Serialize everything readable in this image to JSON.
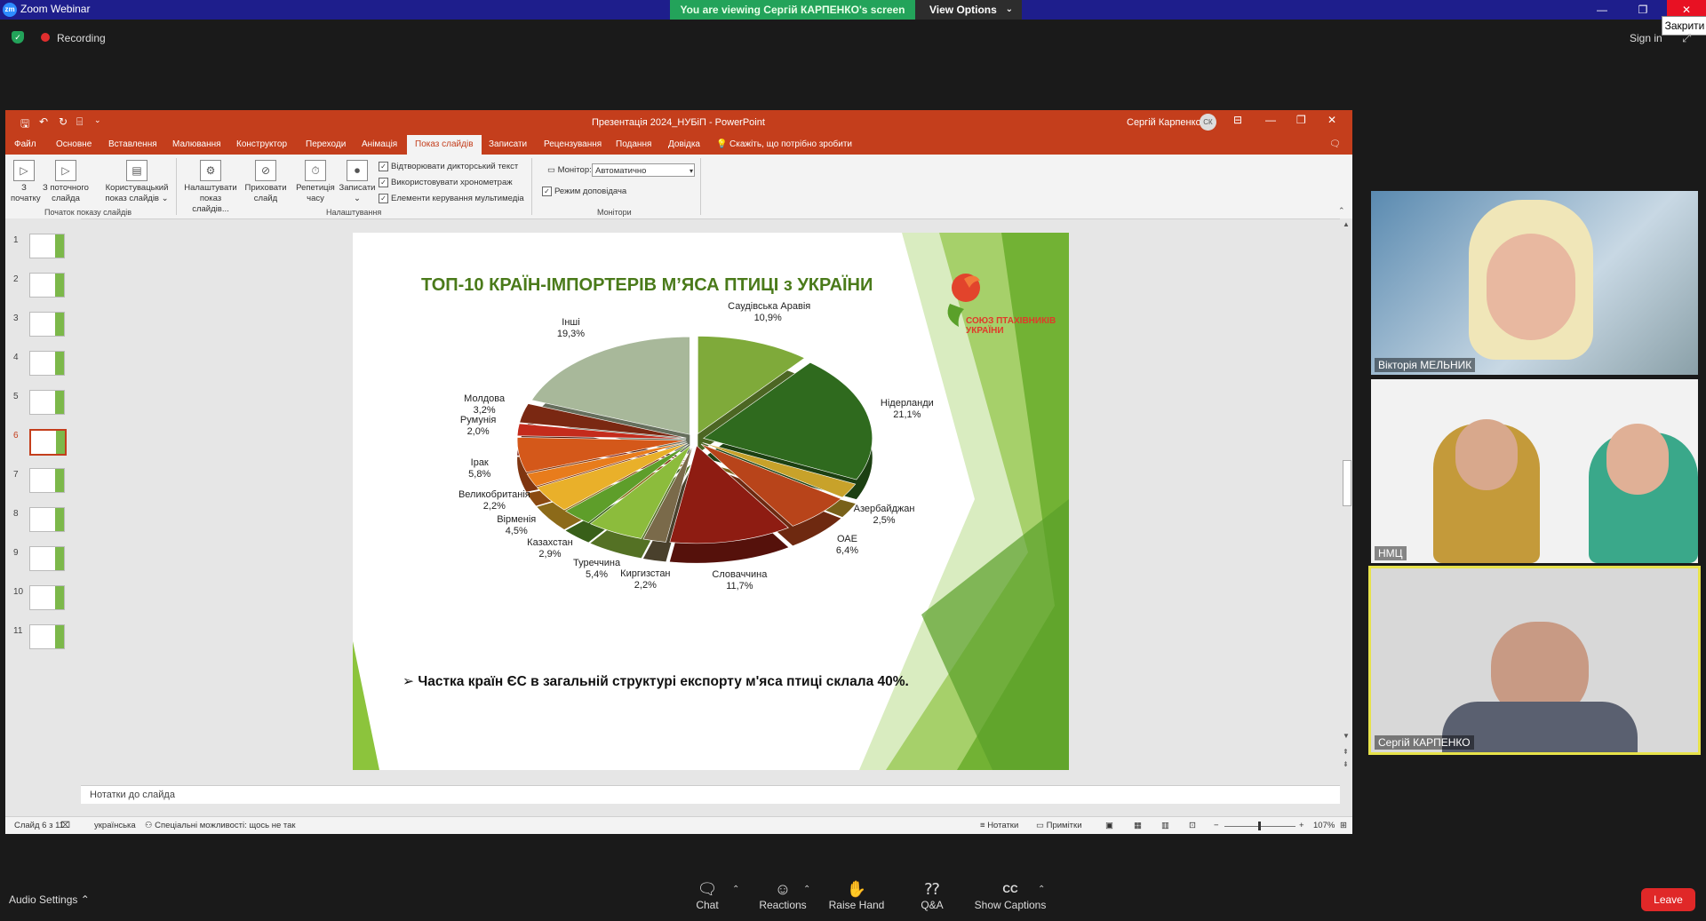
{
  "zoom": {
    "logo": "zm",
    "app_title": "Zoom Webinar",
    "viewing_banner": "You are viewing Сергій КАРПЕНКО's screen",
    "view_options": "View Options",
    "close_tooltip": "Закрити",
    "recording": "Recording",
    "sign_in": "Sign in"
  },
  "ppt": {
    "title": "Презентація 2024_НУБіП  -  PowerPoint",
    "user": "Сергій Карпенко",
    "user_initials": "СК",
    "tabs": [
      "Файл",
      "Основне",
      "Вставлення",
      "Малювання",
      "Конструктор",
      "Переходи",
      "Анімація",
      "Показ слайдів",
      "Записати",
      "Рецензування",
      "Подання",
      "Довідка"
    ],
    "tell_me": "Скажіть, що потрібно зробити",
    "ribbon": {
      "from_start": [
        "З",
        "початку"
      ],
      "from_current": [
        "З поточного",
        "слайда"
      ],
      "custom_show": [
        "Користувацький",
        "показ слайдів ⌄"
      ],
      "group_start": "Початок показу слайдів",
      "setup_show": [
        "Налаштувати",
        "показ слайдів..."
      ],
      "hide_slide": [
        "Приховати",
        "слайд"
      ],
      "rehearse": [
        "Репетиція",
        "часу"
      ],
      "record": [
        "Записати",
        "⌄"
      ],
      "check_narration": "Відтворювати дикторський текст",
      "check_timings": "Використовувати хронометраж",
      "check_media": "Елементи керування мультимедіа",
      "group_setup": "Налаштування",
      "monitor_label": "Монітор:",
      "monitor_value": "Автоматично",
      "presenter_view": "Режим доповідача",
      "group_monitors": "Монітори"
    },
    "thumbnails": [
      "1",
      "2",
      "3",
      "4",
      "5",
      "6",
      "7",
      "8",
      "9",
      "10",
      "11"
    ],
    "selected_slide": 6,
    "notes_placeholder": "Нотатки до слайда",
    "status": {
      "slide_count": "Слайд 6 з 11",
      "language": "українська",
      "accessibility": "Спеціальні можливості: щось не так",
      "notes": "Нотатки",
      "comments": "Примітки",
      "zoom_level": "107%"
    }
  },
  "slide": {
    "title": "ТОП-10 КРАЇН-ІМПОРТЕРІВ М’ЯСА ПТИЦІ з УКРАЇНИ",
    "logo_text": "СОЮЗ ПТАХІВНИКІВ УКРАЇНИ",
    "bullet_marker": "➢",
    "bullet": "Частка країн ЄС в загальній структурі експорту м'яса птиці склала 40%."
  },
  "chart_data": {
    "type": "pie",
    "categories": [
      "Саудівська Аравія",
      "Нідерланди",
      "Азербайджан",
      "ОАЕ",
      "Словаччина",
      "Киргизстан",
      "Туреччина",
      "Казахстан",
      "Вірменія",
      "Великобританія",
      "Ірак",
      "Румунія",
      "Молдова",
      "Інші"
    ],
    "values": [
      10.9,
      21.1,
      2.5,
      6.4,
      11.7,
      2.2,
      5.4,
      2.9,
      4.5,
      2.2,
      5.8,
      2.0,
      3.2,
      19.3
    ],
    "value_labels": [
      "10,9%",
      "21,1%",
      "2,5%",
      "6,4%",
      "11,7%",
      "2,2%",
      "5,4%",
      "2,9%",
      "4,5%",
      "2,2%",
      "5,8%",
      "2,0%",
      "3,2%",
      "19,3%"
    ],
    "colors": [
      "#7faa3a",
      "#2f6a1e",
      "#c8a22a",
      "#b8441a",
      "#8e1c12",
      "#7a6a4a",
      "#8cbc3c",
      "#5e9e2a",
      "#e9b02a",
      "#e87c1c",
      "#d4581a",
      "#c42b1c",
      "#7a2812",
      "#a8b89a"
    ]
  },
  "participants": [
    {
      "name": "Вікторія МЕЛЬНИК"
    },
    {
      "name": "НМЦ"
    },
    {
      "name": "Сергій КАРПЕНКО"
    }
  ],
  "toolbar": {
    "audio_settings": "Audio Settings",
    "chat": "Chat",
    "reactions": "Reactions",
    "raise_hand": "Raise Hand",
    "qa": "Q&A",
    "captions": "Show Captions",
    "captions_icon": "CC",
    "leave": "Leave"
  }
}
